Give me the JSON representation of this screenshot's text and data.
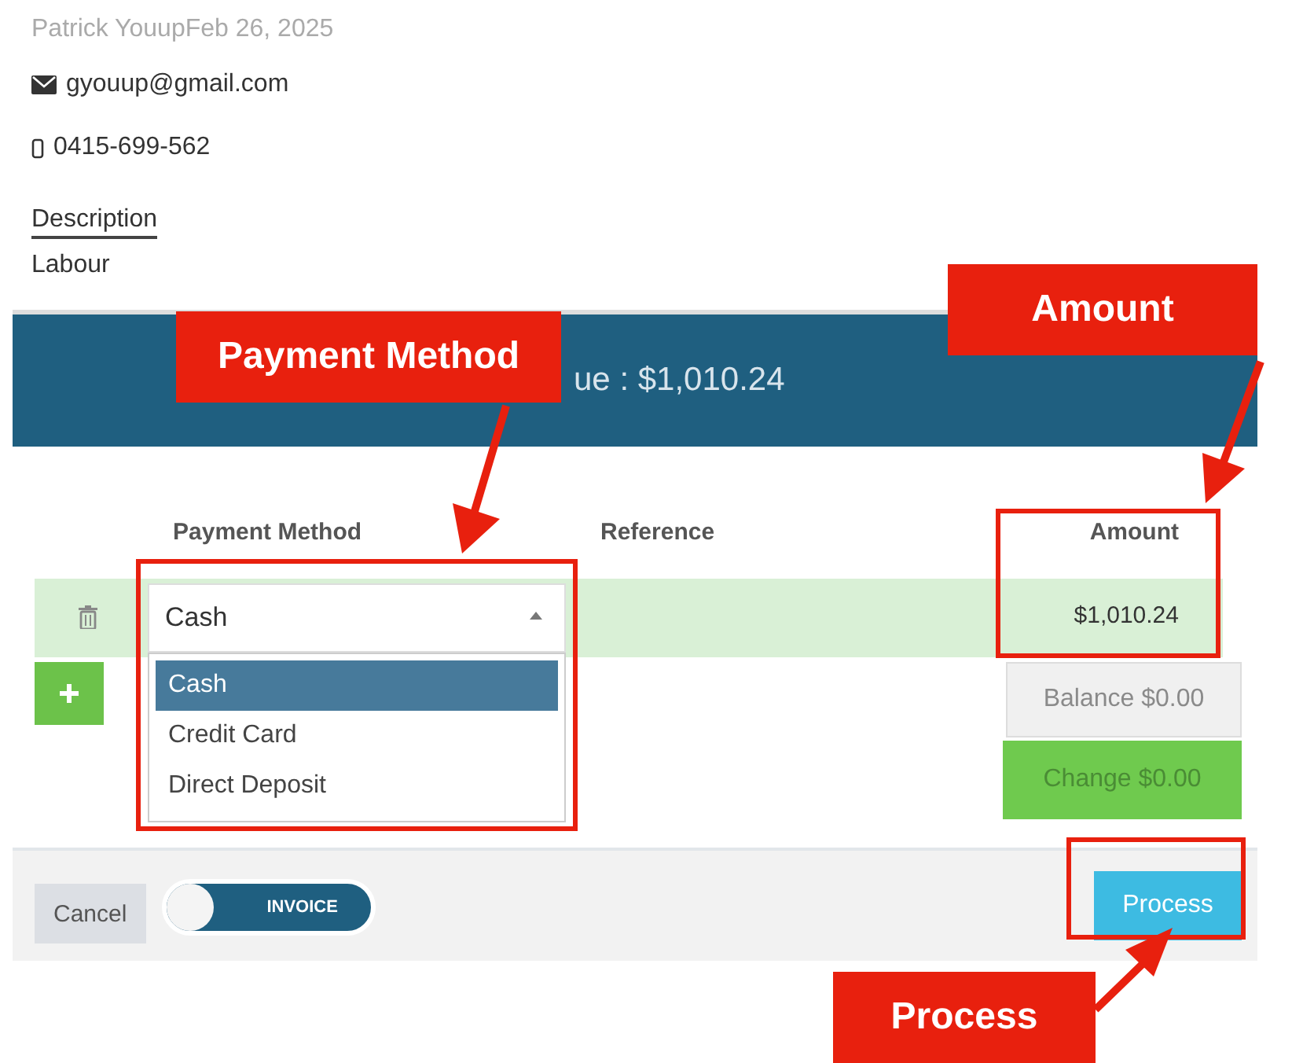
{
  "customer": {
    "name_date": "Patrick YouupFeb 26, 2025",
    "email": "gyouup@gmail.com",
    "phone": "0415-699-562",
    "description_label": "Description",
    "description": "Labour"
  },
  "banner": {
    "text": "ue : $1,010.24"
  },
  "table": {
    "columns": [
      "Payment Method",
      "Reference",
      "Amount"
    ],
    "rows": [
      {
        "method": "Cash",
        "amount": "$1,010.24"
      }
    ]
  },
  "dropdown": {
    "options": [
      {
        "label": "Cash",
        "selected": true
      },
      {
        "label": "Credit Card",
        "selected": false
      },
      {
        "label": "Direct Deposit",
        "selected": false
      }
    ]
  },
  "balance": "Balance $0.00",
  "change": "Change $0.00",
  "footer": {
    "cancel": "Cancel",
    "toggle": {
      "label": "INVOICE",
      "on": true
    },
    "process": "Process"
  },
  "annotations": [
    {
      "label": "Payment Method"
    },
    {
      "label": "Amount"
    },
    {
      "label": "Process"
    }
  ]
}
